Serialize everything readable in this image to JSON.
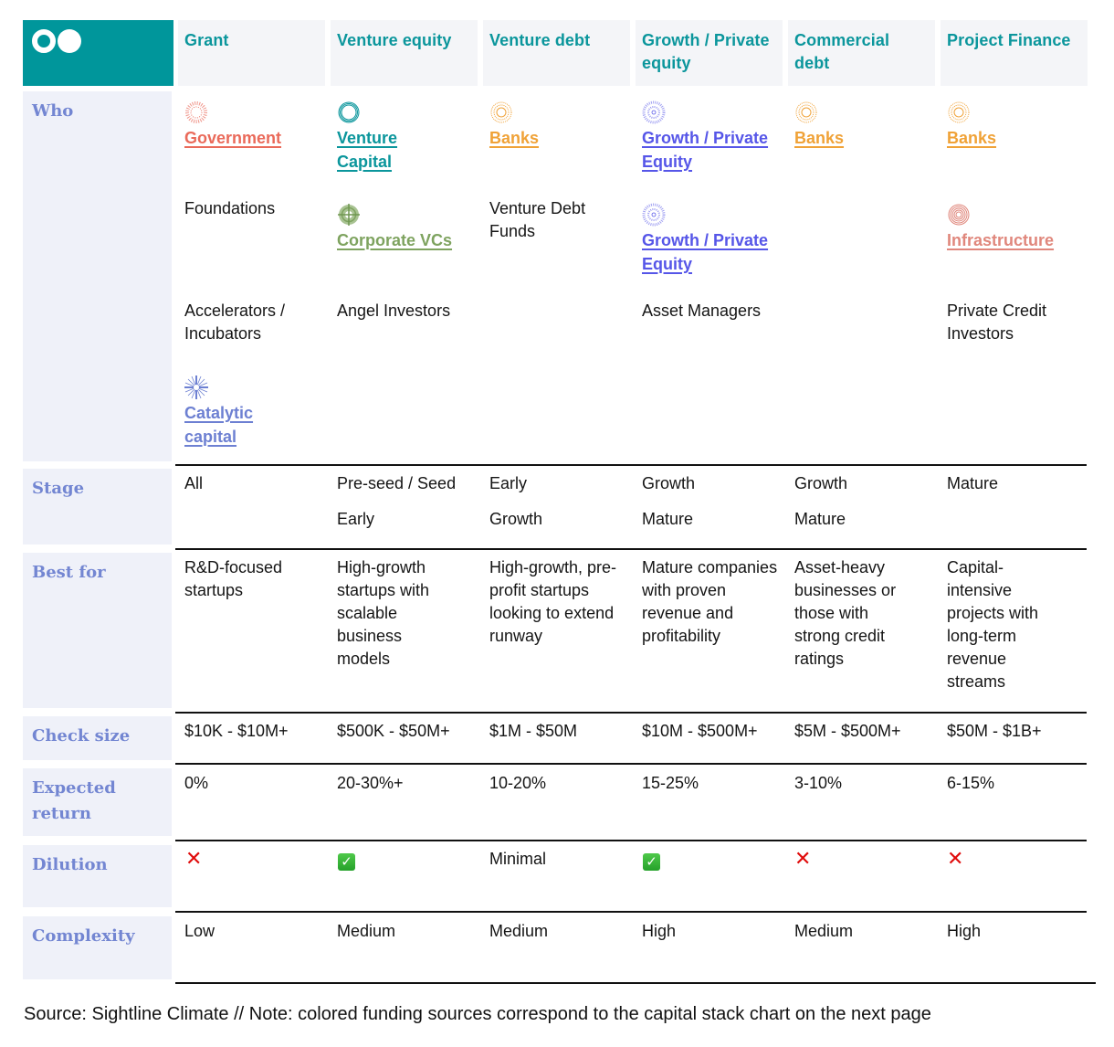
{
  "colors": {
    "brand_teal": "#00969b",
    "header_bg": "#f4f5f8",
    "label_bg": "#eff1f9",
    "label_text": "#7386d2",
    "government": "#ea6a5a",
    "venture_capital": "#0b969c",
    "corporate_vcs": "#7ea35f",
    "banks": "#f0a237",
    "growth_pe": "#5656e8",
    "infrastructure": "#e0877c",
    "catalytic": "#6d80d2",
    "no_mark": "#e00b0b",
    "yes_mark": "#2fb13a"
  },
  "header": {
    "logo_icon": "two-circles-logo",
    "columns": [
      "Grant",
      "Venture equity",
      "Venture debt",
      "Growth / Private equity",
      "Commercial debt",
      "Project Finance"
    ]
  },
  "rows": {
    "who": {
      "label": "Who",
      "columns": [
        [
          {
            "type": "source",
            "text": "Government",
            "icon": "government-dotted-ring-icon",
            "color_key": "government"
          },
          {
            "type": "text",
            "text": "Foundations"
          },
          {
            "type": "text",
            "text": "Accelerators / Incubators"
          },
          {
            "type": "source",
            "text": "Catalytic capital",
            "icon": "catalytic-starburst-icon",
            "color_key": "catalytic"
          }
        ],
        [
          {
            "type": "source",
            "text": "Venture Capital",
            "icon": "venture-capital-ring-icon",
            "color_key": "venture_capital"
          },
          {
            "type": "source",
            "text": "Corporate VCs",
            "icon": "corporate-vc-target-icon",
            "color_key": "corporate_vcs"
          },
          {
            "type": "text",
            "text": "Angel Investors"
          }
        ],
        [
          {
            "type": "source",
            "text": "Banks",
            "icon": "banks-dotted-ring-icon",
            "color_key": "banks"
          },
          {
            "type": "text",
            "text": "Venture Debt Funds"
          }
        ],
        [
          {
            "type": "source",
            "text": "Growth / Private Equity",
            "icon": "growth-pe-dotted-ring-icon",
            "color_key": "growth_pe"
          },
          {
            "type": "source",
            "text": "Growth / Private Equity",
            "icon": "growth-pe-dotted-ring-icon",
            "color_key": "growth_pe"
          },
          {
            "type": "text",
            "text": "Asset Managers"
          }
        ],
        [
          {
            "type": "source",
            "text": "Banks",
            "icon": "banks-dotted-ring-icon",
            "color_key": "banks"
          }
        ],
        [
          {
            "type": "source",
            "text": "Banks",
            "icon": "banks-dotted-ring-icon",
            "color_key": "banks"
          },
          {
            "type": "source",
            "text": "Infrastructure",
            "icon": "infrastructure-concentric-icon",
            "color_key": "infrastructure"
          },
          {
            "type": "text",
            "text": "Private Credit Investors"
          }
        ]
      ]
    },
    "stage": {
      "label": "Stage",
      "columns": [
        [
          "All"
        ],
        [
          "Pre-seed / Seed",
          "Early"
        ],
        [
          "Early",
          "Growth"
        ],
        [
          "Growth",
          "Mature"
        ],
        [
          "Growth",
          "Mature"
        ],
        [
          "Mature"
        ]
      ]
    },
    "best_for": {
      "label": "Best for",
      "columns": [
        "R&D-focused startups",
        "High-growth startups with scalable business models",
        "High-growth, pre-profit startups looking to extend runway",
        "Mature companies with proven revenue and profitability",
        "Asset-heavy businesses or those with strong credit ratings",
        "Capital-intensive projects with long-term revenue streams"
      ]
    },
    "check_size": {
      "label": "Check size",
      "columns": [
        "$10K - $10M+",
        "$500K - $50M+",
        "$1M - $50M",
        "$10M - $500M+",
        "$5M - $500M+",
        "$50M - $1B+"
      ]
    },
    "expected_return": {
      "label": "Expected return",
      "columns": [
        "0%",
        "20-30%+",
        "10-20%",
        "15-25%",
        "3-10%",
        "6-15%"
      ]
    },
    "dilution": {
      "label": "Dilution",
      "columns": [
        {
          "type": "no",
          "glyph": "✕"
        },
        {
          "type": "yes",
          "glyph": "✓"
        },
        {
          "type": "text",
          "text": "Minimal"
        },
        {
          "type": "yes",
          "glyph": "✓"
        },
        {
          "type": "no",
          "glyph": "✕"
        },
        {
          "type": "no",
          "glyph": "✕"
        }
      ]
    },
    "complexity": {
      "label": "Complexity",
      "columns": [
        "Low",
        "Medium",
        "Medium",
        "High",
        "Medium",
        "High"
      ]
    }
  },
  "footnote": "Source: Sightline Climate // Note: colored funding sources correspond to the capital stack chart on the next page"
}
